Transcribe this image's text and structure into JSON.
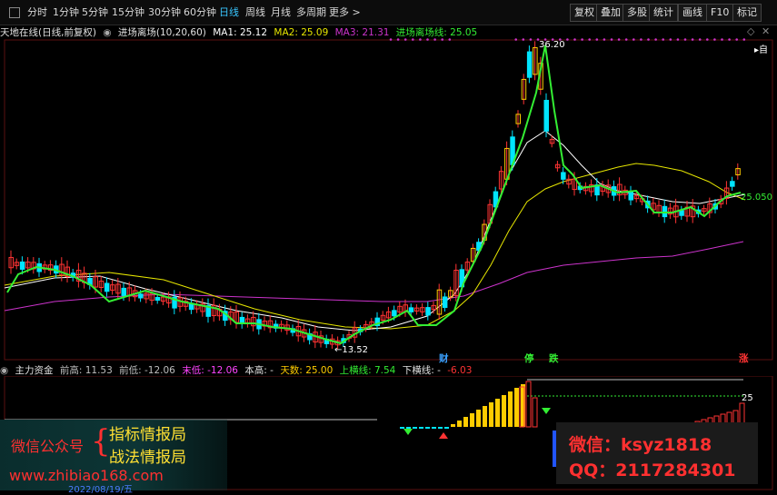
{
  "toolbar": {
    "periods": [
      "分时",
      "1分钟",
      "5分钟",
      "15分钟",
      "30分钟",
      "60分钟",
      "日线",
      "周线",
      "月线",
      "多周期",
      "更多 >"
    ],
    "active_period": "日线",
    "right_buttons": [
      "复权",
      "叠加",
      "多股",
      "统计",
      "画线",
      "F10",
      "标记"
    ]
  },
  "legend": {
    "title": "天地在线(日线,前复权)",
    "indicator": "进场离场(10,20,60)",
    "ma1": "MA1: 25.12",
    "ma2": "MA2: 25.09",
    "ma3": "MA3: 21.31",
    "line": "进场离场线: 25.05"
  },
  "main": {
    "high_label": "36.20",
    "low_label": "←13.52",
    "right_label": "25.050",
    "events": [
      "财",
      "停",
      "跌",
      "涨"
    ]
  },
  "sub": {
    "name": "主力资金",
    "prev_high": "前高: 11.53",
    "prev_low": "前低: -12.06",
    "new_low": "末低: -12.06",
    "cur_high": "本高: -",
    "tianshu": "天数: 25.00",
    "upper": "上横线: 7.54",
    "lower": "下横线: -",
    "last": "-6.03",
    "right_value": "25"
  },
  "watermark": {
    "wechat_label": "微信公众号",
    "brace": "{",
    "line1": "指标情报局",
    "line2": "战法情报局",
    "url": "www.zhibiao168.com",
    "date": "2022/08/19/五",
    "wechat_id": "微信：ksyz1818",
    "qq": "QQ：2117284301"
  },
  "colors": {
    "up": "#ff3333",
    "down": "#00e5ff",
    "yellow_bar": "#ffcc00",
    "ma1": "#ffffff",
    "ma2": "#e6e600",
    "ma3": "#cc33cc",
    "entry_line": "#33ee33",
    "active_tab": "#39c6ff",
    "watermark_red": "#ff3030"
  }
}
